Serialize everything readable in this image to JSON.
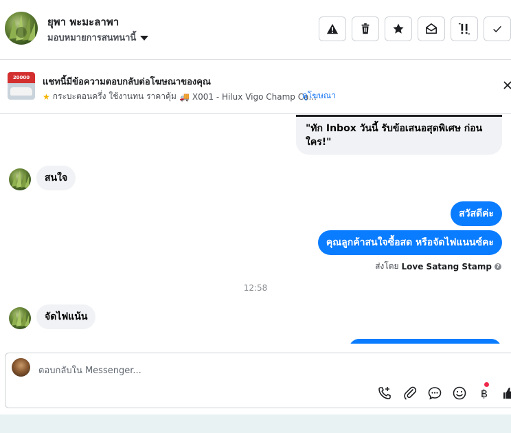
{
  "header": {
    "contact_name": "ยุพา พะมะลาพา",
    "assign_label": "มอบหมายการสนทนานี้",
    "actions": [
      {
        "icon": "warning-icon"
      },
      {
        "icon": "trash-icon"
      },
      {
        "icon": "star-icon"
      },
      {
        "icon": "open-envelope-icon"
      },
      {
        "icon": "follow-up-icon"
      },
      {
        "icon": "checkmark-icon"
      }
    ]
  },
  "ad_banner": {
    "thumb_text": "20000",
    "title": "แชทนี้มีข้อความตอบกลับต่อโฆษณาของคุณ",
    "subtitle_part1": "กระบะตอนครึ่ง ใช้งานทน ราคาคุ้ม",
    "subtitle_part2": "X001 - Hilux Vigo Champ Ca...",
    "link": "ดูโฆษณา"
  },
  "messages": {
    "card_text": "\"ทัก Inbox วันนี้ รับข้อเสนอสุดพิเศษ ก่อนใคร!\"",
    "in_1": "สนใจ",
    "out_1": "สวัสดีค่ะ",
    "out_2": "คุณลูกค้าสนใจซื้อสด หรือจัดไฟแนนซ์คะ",
    "sent_by_prefix": "ส่งโดย",
    "sent_by_name": "Love Satang Stamp",
    "timestamp": "12:58",
    "in_2": "จัดไฟแน้น"
  },
  "composer": {
    "placeholder": "ตอบกลับใน Messenger..."
  },
  "colors": {
    "outgoing_bubble": "#0a7cff",
    "incoming_bubble": "#f0f2f5",
    "link": "#1877f2",
    "notification_dot": "#f02849"
  }
}
